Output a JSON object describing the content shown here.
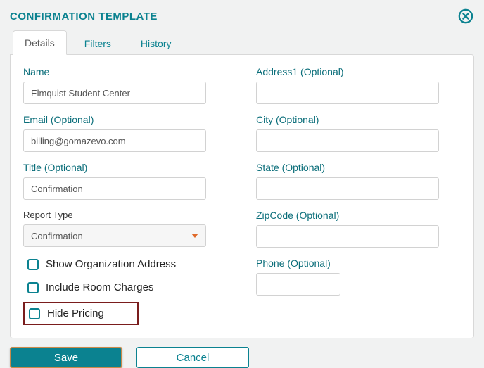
{
  "dialog": {
    "title": "CONFIRMATION TEMPLATE"
  },
  "tabs": {
    "details": "Details",
    "filters": "Filters",
    "history": "History"
  },
  "form": {
    "name_label": "Name",
    "name_value": "Elmquist Student Center",
    "email_label": "Email (Optional)",
    "email_value": "billing@gomazevo.com",
    "title_label": "Title (Optional)",
    "title_value": "Confirmation",
    "report_type_label": "Report Type",
    "report_type_value": "Confirmation",
    "address1_label": "Address1 (Optional)",
    "address1_value": "",
    "city_label": "City (Optional)",
    "city_value": "",
    "state_label": "State (Optional)",
    "state_value": "",
    "zipcode_label": "ZipCode (Optional)",
    "zipcode_value": "",
    "phone_label": "Phone (Optional)",
    "phone_value": ""
  },
  "checkboxes": {
    "show_org_address": "Show Organization Address",
    "include_room_charges": "Include Room Charges",
    "hide_pricing": "Hide Pricing"
  },
  "footer": {
    "save": "Save",
    "cancel": "Cancel"
  }
}
